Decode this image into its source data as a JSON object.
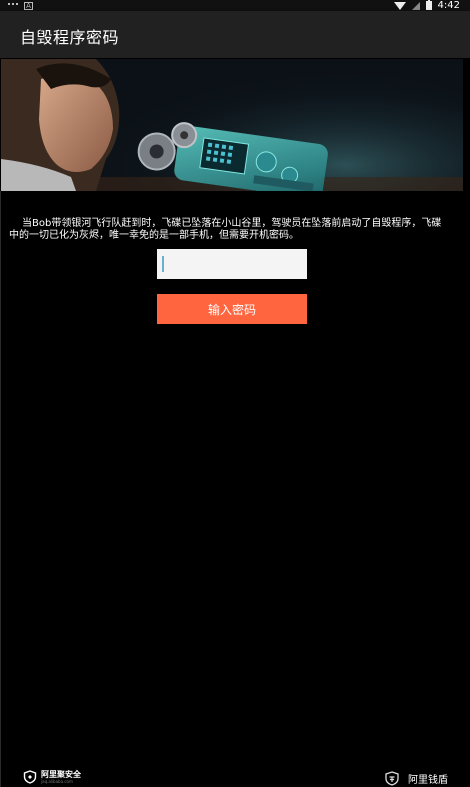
{
  "status_bar": {
    "time": "4:42",
    "icons": [
      "notification-dots-icon",
      "notification-a-icon",
      "wifi-icon",
      "signal-icon",
      "battery-icon"
    ],
    "notif_badge": "A"
  },
  "app_bar": {
    "title": "自毁程序密码"
  },
  "banner": {
    "icon": "boy-and-device-illustration"
  },
  "content": {
    "story": "当Bob带领银河飞行队赶到时，飞碟已坠落在小山谷里，驾驶员在坠落前启动了自毁程序，飞碟中的一切已化为灰烬，唯一幸免的是一部手机，但需要开机密码。"
  },
  "form": {
    "password_value": "",
    "password_placeholder": "",
    "submit_label": "输入密码"
  },
  "footer": {
    "left_brand": "阿里聚安全",
    "left_brand_sub": "jaq.alibaba.com",
    "right_brand": "阿里钱盾",
    "left_icon": "shield-icon",
    "right_icon": "qiandun-shield-icon"
  },
  "colors": {
    "background": "#000000",
    "app_bar": "#212121",
    "accent_button": "#ff6640",
    "input_bg": "#f4f4f4"
  }
}
